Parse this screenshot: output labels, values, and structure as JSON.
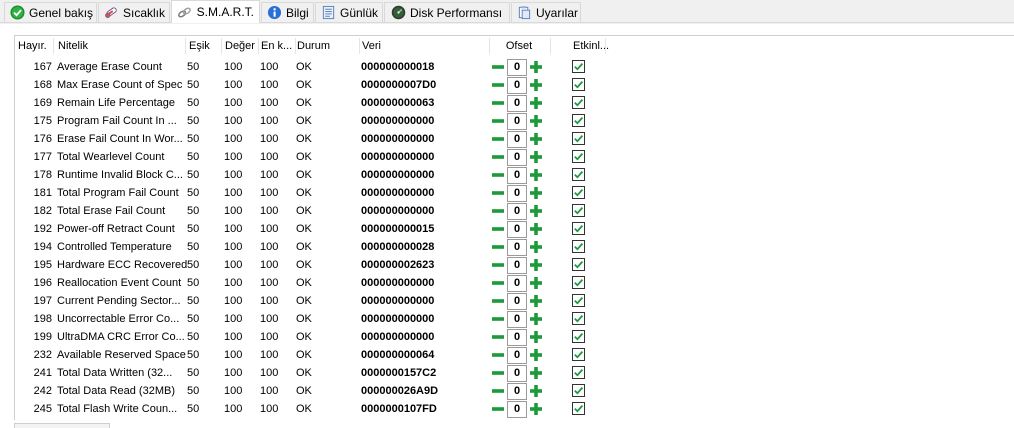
{
  "tabs": [
    {
      "label": "Genel bakış",
      "icon": "check-circle-icon"
    },
    {
      "label": "Sıcaklık",
      "icon": "thermometer-icon"
    },
    {
      "label": "S.M.A.R.T.",
      "icon": "link-chain-icon"
    },
    {
      "label": "Bilgi",
      "icon": "info-icon"
    },
    {
      "label": "Günlük",
      "icon": "log-document-icon"
    },
    {
      "label": "Disk Performansı",
      "icon": "gauge-icon"
    },
    {
      "label": "Uyarılar",
      "icon": "clipboard-alert-icon"
    }
  ],
  "columns": {
    "id": "Hayır.",
    "attribute": "Nitelik",
    "threshold": "Eşik",
    "value": "Değer",
    "worst": "En k...",
    "status": "Durum",
    "data": "Veri",
    "offset": "Ofset",
    "enabled": "Etkinl..."
  },
  "colors": {
    "minus": "#1e9a3c",
    "plus": "#1e9a3c",
    "check": "#1e9a3c"
  },
  "rows": [
    {
      "id": "167",
      "name": "Average Erase Count",
      "threshold": "50",
      "value": "100",
      "worst": "100",
      "status": "OK",
      "data": "000000000018",
      "offset": "0",
      "enabled": true
    },
    {
      "id": "168",
      "name": "Max Erase Count of Spec",
      "threshold": "50",
      "value": "100",
      "worst": "100",
      "status": "OK",
      "data": "0000000007D0",
      "offset": "0",
      "enabled": true
    },
    {
      "id": "169",
      "name": "Remain Life Percentage",
      "threshold": "50",
      "value": "100",
      "worst": "100",
      "status": "OK",
      "data": "000000000063",
      "offset": "0",
      "enabled": true
    },
    {
      "id": "175",
      "name": "Program Fail Count In ...",
      "threshold": "50",
      "value": "100",
      "worst": "100",
      "status": "OK",
      "data": "000000000000",
      "offset": "0",
      "enabled": true
    },
    {
      "id": "176",
      "name": "Erase Fail Count In Wor...",
      "threshold": "50",
      "value": "100",
      "worst": "100",
      "status": "OK",
      "data": "000000000000",
      "offset": "0",
      "enabled": true
    },
    {
      "id": "177",
      "name": "Total Wearlevel Count",
      "threshold": "50",
      "value": "100",
      "worst": "100",
      "status": "OK",
      "data": "000000000000",
      "offset": "0",
      "enabled": true
    },
    {
      "id": "178",
      "name": "Runtime Invalid Block C...",
      "threshold": "50",
      "value": "100",
      "worst": "100",
      "status": "OK",
      "data": "000000000000",
      "offset": "0",
      "enabled": true
    },
    {
      "id": "181",
      "name": "Total Program Fail Count",
      "threshold": "50",
      "value": "100",
      "worst": "100",
      "status": "OK",
      "data": "000000000000",
      "offset": "0",
      "enabled": true
    },
    {
      "id": "182",
      "name": "Total Erase Fail Count",
      "threshold": "50",
      "value": "100",
      "worst": "100",
      "status": "OK",
      "data": "000000000000",
      "offset": "0",
      "enabled": true
    },
    {
      "id": "192",
      "name": "Power-off Retract Count",
      "threshold": "50",
      "value": "100",
      "worst": "100",
      "status": "OK",
      "data": "000000000015",
      "offset": "0",
      "enabled": true
    },
    {
      "id": "194",
      "name": "Controlled Temperature",
      "threshold": "50",
      "value": "100",
      "worst": "100",
      "status": "OK",
      "data": "000000000028",
      "offset": "0",
      "enabled": true
    },
    {
      "id": "195",
      "name": "Hardware ECC Recovered",
      "threshold": "50",
      "value": "100",
      "worst": "100",
      "status": "OK",
      "data": "000000002623",
      "offset": "0",
      "enabled": true
    },
    {
      "id": "196",
      "name": "Reallocation Event Count",
      "threshold": "50",
      "value": "100",
      "worst": "100",
      "status": "OK",
      "data": "000000000000",
      "offset": "0",
      "enabled": true
    },
    {
      "id": "197",
      "name": "Current Pending Sector...",
      "threshold": "50",
      "value": "100",
      "worst": "100",
      "status": "OK",
      "data": "000000000000",
      "offset": "0",
      "enabled": true
    },
    {
      "id": "198",
      "name": "Uncorrectable Error Co...",
      "threshold": "50",
      "value": "100",
      "worst": "100",
      "status": "OK",
      "data": "000000000000",
      "offset": "0",
      "enabled": true
    },
    {
      "id": "199",
      "name": "UltraDMA CRC Error Co...",
      "threshold": "50",
      "value": "100",
      "worst": "100",
      "status": "OK",
      "data": "000000000000",
      "offset": "0",
      "enabled": true
    },
    {
      "id": "232",
      "name": "Available Reserved Space",
      "threshold": "50",
      "value": "100",
      "worst": "100",
      "status": "OK",
      "data": "000000000064",
      "offset": "0",
      "enabled": true
    },
    {
      "id": "241",
      "name": "Total Data Written (32...",
      "threshold": "50",
      "value": "100",
      "worst": "100",
      "status": "OK",
      "data": "0000000157C2",
      "offset": "0",
      "enabled": true
    },
    {
      "id": "242",
      "name": "Total Data Read (32MB)",
      "threshold": "50",
      "value": "100",
      "worst": "100",
      "status": "OK",
      "data": "000000026A9D",
      "offset": "0",
      "enabled": true
    },
    {
      "id": "245",
      "name": "Total Flash Write Coun...",
      "threshold": "50",
      "value": "100",
      "worst": "100",
      "status": "OK",
      "data": "0000000107FD",
      "offset": "0",
      "enabled": true
    }
  ]
}
